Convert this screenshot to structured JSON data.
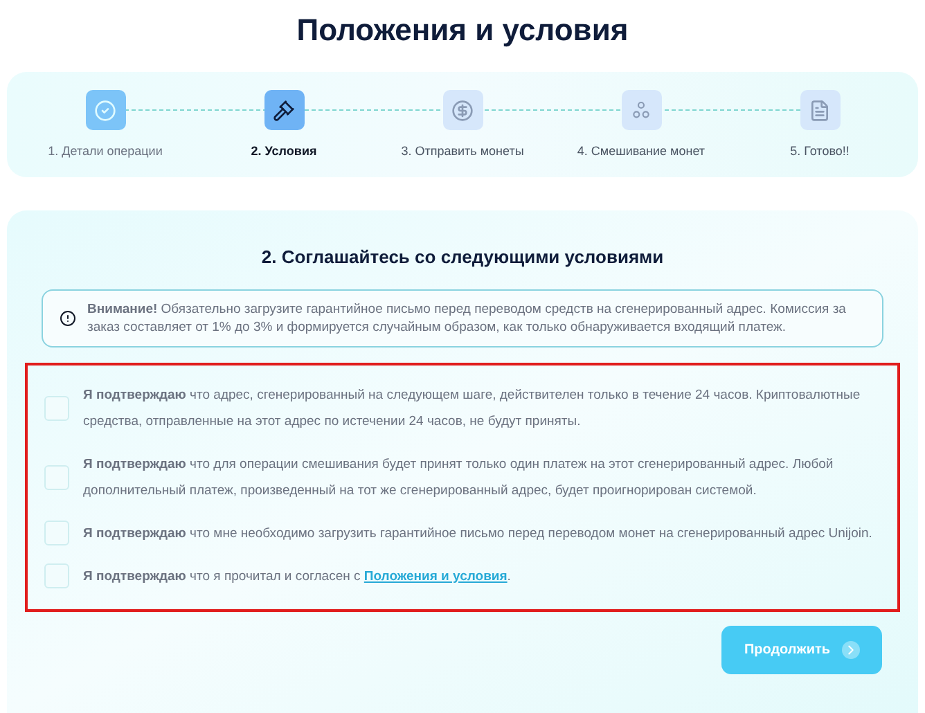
{
  "title": "Положения и условия",
  "steps": [
    {
      "label": "1. Детали операции",
      "kind": "done"
    },
    {
      "label": "2. Условия",
      "kind": "current"
    },
    {
      "label": "3. Отправить монеты",
      "kind": "todo"
    },
    {
      "label": "4. Смешивание монет",
      "kind": "todo"
    },
    {
      "label": "5. Готово!!",
      "kind": "todo"
    }
  ],
  "section_heading": "2. Соглашайтесь со следующими условиями",
  "notice": "**Внимание!** Обязательно загрузите гарантийное письмо перед переводом средств на сгенерированный адрес. Комиссия за заказ составляет от 1% до 3% и формируется случайным образом, как только обнаруживается входящий платеж.",
  "confirmations": [
    {
      "text": "**Я подтверждаю** что адрес, сгенерированный на следующем шаге, действителен только в течение 24 часов. Криптовалютные средства, отправленные на этот адрес по истечении 24 часов, не будут приняты.",
      "checked": false
    },
    {
      "text": "**Я подтверждаю** что для операции смешивания будет принят только один платеж на этот сгенерированный адрес. Любой дополнительный платеж, произведенный на тот же сгенерированный адрес, будет проигнорирован системой.",
      "checked": false
    },
    {
      "text": "**Я подтверждаю** что мне необходимо загрузить гарантийное письмо перед переводом монет на сгенерированный адрес Unijoin.",
      "checked": false
    },
    {
      "text": "**Я подтверждаю** что я прочитал и согласен с",
      "link": "Положения и условия",
      "after": ".",
      "checked": false
    }
  ],
  "continue_button": "Продолжить"
}
